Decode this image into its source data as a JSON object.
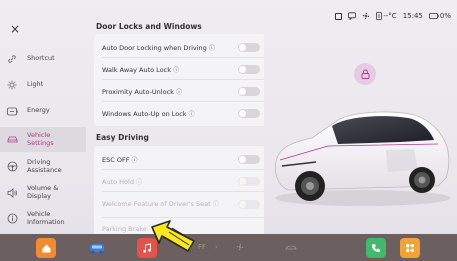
{
  "status_bar": {
    "temperature": "--°C",
    "time": "15:45",
    "battery": "0%"
  },
  "sidebar": {
    "close_label": "×",
    "items": [
      {
        "label": "Shortcut",
        "icon": "link-icon"
      },
      {
        "label": "Light",
        "icon": "light-icon"
      },
      {
        "label": "Energy",
        "icon": "battery-icon"
      },
      {
        "label": "Vehicle Settings",
        "icon": "car-settings-icon",
        "active": true
      },
      {
        "label": "Driving Assistance",
        "icon": "steering-wheel-icon"
      },
      {
        "label": "Volume & Display",
        "icon": "volume-icon"
      },
      {
        "label": "Vehicle Information",
        "icon": "info-icon"
      }
    ]
  },
  "door_locks": {
    "title": "Door Locks and Windows",
    "rows": [
      {
        "label": "Auto Door Locking when Driving",
        "info": "ⓘ",
        "state": "off"
      },
      {
        "label": "Walk Away Auto Lock",
        "info": "ⓘ",
        "state": "off"
      },
      {
        "label": "Proximity Auto-Unlock",
        "info": "ⓘ",
        "state": "off"
      },
      {
        "label": "Windows Auto-Up on Lock",
        "info": "ⓘ",
        "state": "off"
      }
    ]
  },
  "easy_driving": {
    "title": "Easy Driving",
    "rows": [
      {
        "label": "ESC OFF",
        "info": "ⓘ",
        "state": "off",
        "enabled": true
      },
      {
        "label": "Auto Hold",
        "info": "ⓘ",
        "state": "off",
        "enabled": false
      },
      {
        "label": "Welcome Feature of Driver's Seat",
        "info": "ⓘ",
        "state": "off",
        "enabled": false
      },
      {
        "label": "Parking Brake",
        "enabled": false
      }
    ]
  },
  "dock": {
    "temp_text": "FF",
    "items": [
      "home-icon",
      "car-icon",
      "music-icon",
      "fan-icon",
      "seat-icon",
      "phone-icon",
      "apps-icon"
    ]
  },
  "colors": {
    "accent": "#b4368f",
    "dock_bg": "#6b5f60",
    "home": "#f28a2e",
    "car": "#3f7fd6",
    "music": "#e5524a",
    "phone": "#43b96b",
    "apps": "#f4a233"
  }
}
